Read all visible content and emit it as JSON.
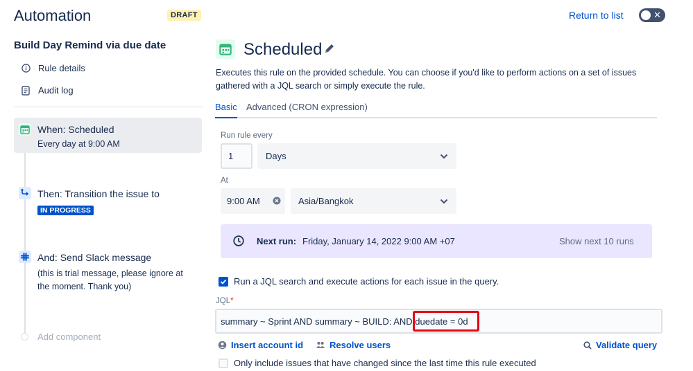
{
  "header": {
    "app_title": "Automation",
    "draft_badge": "DRAFT",
    "return_link": "Return to list"
  },
  "sidebar": {
    "rule_name": "Build Day Remind via due date",
    "links": [
      {
        "label": "Rule details",
        "icon": "info-icon"
      },
      {
        "label": "Audit log",
        "icon": "document-icon"
      }
    ],
    "steps": [
      {
        "title": "When: Scheduled",
        "subtitle": "Every day at 9:00 AM",
        "icon": "calendar-icon",
        "color": "#36b37e"
      },
      {
        "title": "Then: Transition the issue to",
        "lozenge": "IN PROGRESS",
        "icon": "transition-icon",
        "color": "#0052cc"
      },
      {
        "title": "And: Send Slack message",
        "subtitle_lines": [
          "(this is trial message, please ignore at",
          "the moment. Thank you)"
        ],
        "icon": "slack-icon",
        "color": "#0052cc"
      }
    ],
    "add_component": "Add component"
  },
  "main": {
    "title": "Scheduled",
    "description_lines": [
      "Executes this rule on the provided schedule. You can choose if you'd like to perform actions on a set of issues",
      "gathered with a JQL search or simply execute the rule."
    ],
    "tabs": [
      {
        "label": "Basic",
        "active": true
      },
      {
        "label": "Advanced (CRON expression)",
        "active": false
      }
    ],
    "run_every": {
      "label": "Run rule every",
      "value": "1",
      "unit": "Days"
    },
    "at": {
      "label": "At",
      "time": "9:00 AM",
      "timezone": "Asia/Bangkok"
    },
    "next_run": {
      "label": "Next run:",
      "value": "Friday, January 14, 2022 9:00 AM +07",
      "show_more": "Show next 10 runs"
    },
    "jql_checkbox": {
      "label": "Run a JQL search and execute actions for each issue in the query.",
      "checked": true
    },
    "jql": {
      "label": "JQL",
      "required_mark": "*",
      "value": "summary ~ Sprint AND summary ~ BUILD: AND duedate = 0d"
    },
    "actions": {
      "insert_account": "Insert account id",
      "resolve_users": "Resolve users",
      "validate": "Validate query"
    },
    "changed_checkbox": {
      "label": "Only include issues that have changed since the last time this rule executed",
      "checked": false
    }
  },
  "colors": {
    "accent": "#0052cc",
    "highlight": "#e30613",
    "next_run_bg": "#eae6ff",
    "draft_bg": "#fff0b3"
  }
}
